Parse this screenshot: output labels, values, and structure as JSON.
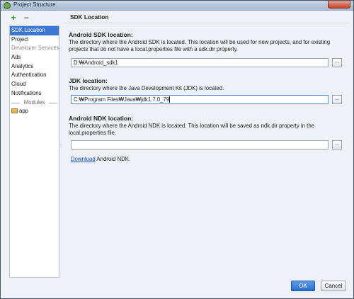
{
  "window": {
    "title": "Project Structure"
  },
  "sidebar": {
    "items": [
      {
        "label": "SDK Location",
        "selected": true
      },
      {
        "label": "Project"
      },
      {
        "label": "Developer Services",
        "section": true
      },
      {
        "label": "Ads"
      },
      {
        "label": "Analytics"
      },
      {
        "label": "Authentication"
      },
      {
        "label": "Cloud"
      },
      {
        "label": "Notifications"
      }
    ],
    "modules_label": "Modules",
    "modules": [
      {
        "label": "app",
        "icon": "folder-icon"
      }
    ]
  },
  "page": {
    "title": "SDK Location"
  },
  "android_sdk": {
    "title": "Android SDK location:",
    "desc": "The directory where the Android SDK is located. This location will be used for new projects, and for existing projects that do not have a local.properties file with a sdk.dir property.",
    "value": "D:₩Android_sdk1",
    "browse": "..."
  },
  "jdk": {
    "title": "JDK location:",
    "desc": "The directory where the Java Development Kit (JDK) is located.",
    "value": "C:₩Program Files₩Java₩jdk1.7.0_79",
    "browse": "..."
  },
  "ndk": {
    "title": "Android NDK location:",
    "desc": "The directory where the Android NDK is located. This location will be saved as ndk.dir property in the local.properties file.",
    "value": "",
    "browse": "...",
    "download_link": "Download",
    "download_suffix": " Android NDK."
  },
  "buttons": {
    "ok": "OK",
    "cancel": "Cancel"
  },
  "colors": {
    "accent": "#3b76d3",
    "ok_button": "#2c6fd0",
    "link": "#1a4fb8"
  }
}
